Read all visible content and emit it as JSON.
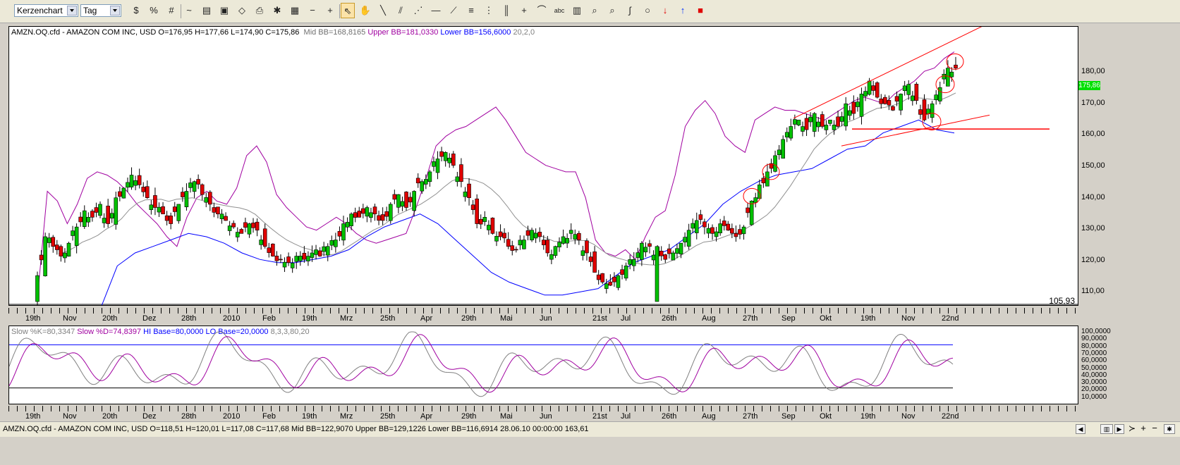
{
  "toolbar": {
    "chart_type": "Kerzenchart",
    "period": "Tag",
    "tools": [
      {
        "name": "dollar-percent-icon",
        "glyph": "$"
      },
      {
        "name": "percent-icon",
        "glyph": "%"
      },
      {
        "name": "grid-icon",
        "glyph": "#"
      },
      {
        "name": "indicator-icon",
        "glyph": "~"
      },
      {
        "name": "template-icon",
        "glyph": "▤"
      },
      {
        "name": "image-icon",
        "glyph": "▣"
      },
      {
        "name": "eraser-icon",
        "glyph": "◇"
      },
      {
        "name": "print-icon",
        "glyph": "⎙"
      },
      {
        "name": "settings-icon",
        "glyph": "✱"
      },
      {
        "name": "table-icon",
        "glyph": "▦"
      },
      {
        "name": "zoom-out-icon",
        "glyph": "−"
      },
      {
        "name": "zoom-in-icon",
        "glyph": "+"
      },
      {
        "name": "cursor-icon",
        "glyph": "⇖"
      },
      {
        "name": "hand-icon",
        "glyph": "✋"
      },
      {
        "name": "line-icon",
        "glyph": "╲"
      },
      {
        "name": "channel-icon",
        "glyph": "⫽"
      },
      {
        "name": "parallel-lines-icon",
        "glyph": "⋰"
      },
      {
        "name": "horizontal-line-icon",
        "glyph": "—"
      },
      {
        "name": "fan-icon",
        "glyph": "⟋"
      },
      {
        "name": "fibonacci-icon",
        "glyph": "≡"
      },
      {
        "name": "retracement-icon",
        "glyph": "⋮"
      },
      {
        "name": "cycle-icon",
        "glyph": "║"
      },
      {
        "name": "crosshair-icon",
        "glyph": "+"
      },
      {
        "name": "arc-icon",
        "glyph": "⌒"
      },
      {
        "name": "text-icon",
        "glyph": "abc"
      },
      {
        "name": "calculator-icon",
        "glyph": "▥"
      },
      {
        "name": "search-icon",
        "glyph": "⌕"
      },
      {
        "name": "zoom-region-icon",
        "glyph": "⌕"
      },
      {
        "name": "freehand-icon",
        "glyph": "∫"
      },
      {
        "name": "circle-icon",
        "glyph": "○"
      },
      {
        "name": "sell-arrow-icon",
        "glyph": "↓"
      },
      {
        "name": "buy-arrow-icon",
        "glyph": "↑"
      },
      {
        "name": "color-palette-icon",
        "glyph": "■"
      }
    ]
  },
  "main_chart": {
    "header": {
      "symbol": "AMZN.OQ.cfd - AMAZON COM INC, USD O=176,95 H=177,66 L=174,90 C=175,86",
      "mid_bb": "Mid BB=168,8165",
      "upper_bb": "Upper BB=181,0330",
      "lower_bb": "Lower BB=156,6000",
      "params": "20,2,0"
    },
    "y_ticks": [
      "180,00",
      "170,00",
      "160,00",
      "150,00",
      "140,00",
      "130,00",
      "120,00",
      "110,00"
    ],
    "last_price": "175,86",
    "min_label": "105,93"
  },
  "stoch_chart": {
    "header": {
      "k": "Slow %K=80,3347",
      "d": "Slow %D=74,8397",
      "hi": "HI Base=80,0000",
      "lo": "LO Base=20,0000",
      "params": "8,3,3,80,20"
    },
    "y_ticks": [
      "100,0000",
      "90,0000",
      "80,0000",
      "70,0000",
      "60,0000",
      "50,0000",
      "40,0000",
      "30,0000",
      "20,0000",
      "10,0000"
    ]
  },
  "x_axis_labels": [
    "19th",
    "Nov",
    "20th",
    "Dez",
    "28th",
    "2010",
    "Feb",
    "19th",
    "Mrz",
    "25th",
    "Apr",
    "29th",
    "Mai",
    "Jun",
    "21st",
    "Jul",
    "26th",
    "Aug",
    "27th",
    "Sep",
    "Okt",
    "19th",
    "Nov",
    "22nd"
  ],
  "status": {
    "text": "AMZN.OQ.cfd - AMAZON COM INC, USD O=118,51 H=120,01 L=117,08 C=117,68  Mid BB=122,9070 Upper BB=129,1226 Lower BB=116,6914  28.06.10 00:00:00 163,61"
  },
  "colors": {
    "bull": "#00c000",
    "bear": "#e00000",
    "upper_bb": "#a000a0",
    "lower_bb": "#0000ff",
    "mid_bb": "#909090",
    "trendline": "#ff0000",
    "stoch_k": "#808080",
    "stoch_d": "#a000a0"
  },
  "chart_data": [
    {
      "type": "candlestick",
      "title": "AMZN.OQ.cfd - AMAZON COM INC, USD",
      "ylim": [
        104,
        187
      ],
      "x_labels": [
        "19th",
        "Nov",
        "20th",
        "Dez",
        "28th",
        "2010",
        "Feb",
        "19th",
        "Mrz",
        "25th",
        "Apr",
        "29th",
        "Mai",
        "Jun",
        "21st",
        "Jul",
        "26th",
        "Aug",
        "27th",
        "Sep",
        "Okt",
        "19th",
        "Nov",
        "22nd"
      ],
      "close_path": [
        112,
        124,
        121,
        118,
        122,
        127,
        132,
        130,
        134,
        128,
        136,
        139,
        143,
        140,
        136,
        133,
        131,
        128,
        134,
        138,
        141,
        137,
        134,
        131,
        129,
        127,
        125,
        128,
        126,
        121,
        118,
        117,
        116,
        118,
        117,
        119,
        118,
        121,
        123,
        128,
        131,
        130,
        133,
        131,
        129,
        134,
        137,
        133,
        138,
        141,
        144,
        148,
        150,
        146,
        141,
        136,
        128,
        130,
        125,
        124,
        121,
        120,
        123,
        126,
        124,
        119,
        121,
        124,
        126,
        123,
        119,
        113,
        110,
        109,
        112,
        115,
        117,
        122,
        121,
        118,
        117,
        119,
        122,
        126,
        129,
        127,
        125,
        128,
        126,
        124,
        127,
        135,
        140,
        144,
        149,
        154,
        158,
        160,
        157,
        162,
        158,
        160,
        158,
        165,
        162,
        168,
        172,
        167,
        165,
        163,
        168,
        171,
        166,
        160,
        165,
        170,
        176,
        176
      ],
      "upper_bb_path": [
        105,
        138,
        135,
        128,
        134,
        142,
        144,
        143,
        141,
        138,
        134,
        131,
        128,
        124,
        121,
        130,
        136,
        138,
        135,
        134,
        139,
        149,
        152,
        147,
        137,
        133,
        130,
        127,
        126,
        128,
        130,
        128,
        125,
        123,
        122,
        123,
        124,
        125,
        133,
        142,
        152,
        155,
        157,
        158,
        160,
        162,
        164,
        160,
        155,
        150,
        148,
        146,
        145,
        144,
        144,
        136,
        123,
        119,
        118,
        120,
        117,
        124,
        130,
        132,
        143,
        158,
        163,
        166,
        162,
        155,
        152,
        150,
        160,
        162,
        164,
        163,
        163,
        162,
        161,
        160,
        162,
        164,
        166,
        167,
        166,
        165,
        168,
        170,
        172,
        175,
        176,
        179,
        181
      ],
      "lower_bb_path": [
        101,
        115,
        119,
        121,
        123,
        125,
        124,
        122,
        119,
        117,
        116,
        116,
        117,
        118,
        120,
        124,
        127,
        129,
        131,
        128,
        123,
        118,
        113,
        110,
        108,
        106,
        106,
        107,
        108,
        112,
        116,
        118,
        120,
        124,
        128,
        134,
        138,
        141,
        143,
        144,
        145,
        148,
        151,
        152,
        156,
        158,
        160,
        157,
        156
      ],
      "stoch_k_range": [
        0,
        100
      ],
      "hi_base": 80,
      "lo_base": 20,
      "hline": 157.2,
      "annotations": [
        "105,93",
        "175,86"
      ]
    }
  ]
}
